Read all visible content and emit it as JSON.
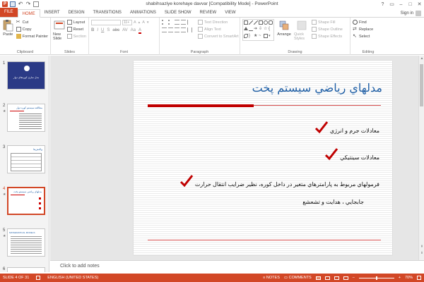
{
  "window": {
    "title": "shabihsaziye korehaye davvar [Compatibility Mode] - PowerPoint",
    "controls": [
      "?",
      "▭",
      "–",
      "□",
      "✕"
    ]
  },
  "tabs": [
    "FILE",
    "HOME",
    "INSERT",
    "DESIGN",
    "TRANSITIONS",
    "ANIMATIONS",
    "SLIDE SHOW",
    "REVIEW",
    "VIEW"
  ],
  "active_tab": "HOME",
  "signin": "Sign in",
  "ribbon": {
    "clipboard": {
      "paste": "Paste",
      "cut": "Cut",
      "copy": "Copy",
      "format_painter": "Format Painter",
      "label": "Clipboard"
    },
    "slides": {
      "new_slide": "New Slide",
      "layout": "Layout",
      "reset": "Reset",
      "section": "Section",
      "label": "Slides"
    },
    "font": {
      "size": "11+",
      "label": "Font",
      "buttons": [
        "B",
        "I",
        "U",
        "S",
        "abc",
        "AV",
        "Aa",
        "A"
      ]
    },
    "paragraph": {
      "text_direction": "Text Direction",
      "align_text": "Align Text",
      "convert_smartart": "Convert to SmartArt",
      "label": "Paragraph"
    },
    "drawing": {
      "arrange": "Arrange",
      "quick_styles": "Quick Styles",
      "shape_fill": "Shape Fill",
      "shape_outline": "Shape Outline",
      "shape_effects": "Shape Effects",
      "label": "Drawing"
    },
    "editing": {
      "find": "Find",
      "replace": "Replace",
      "select": "Select",
      "label": "Editing"
    }
  },
  "thumbnails": [
    {
      "num": "1",
      "star": ""
    },
    {
      "num": "2",
      "star": "★"
    },
    {
      "num": "3",
      "star": ""
    },
    {
      "num": "4",
      "star": "★"
    },
    {
      "num": "5",
      "star": "★"
    },
    {
      "num": "6",
      "star": ""
    }
  ],
  "thumb_texts": {
    "t1_title": "مدل سازی کوره‌های دوار",
    "t2_title": "مطالعه سیستم کوره دوار",
    "t3_title": "واکنش‌ها",
    "t4_title": "مدلهای ریاضی سیستم پخت",
    "t5_title": "MATHEMATICAL MODELS"
  },
  "slide": {
    "title": "مدلهاي رياضي سيستم پخت",
    "bullets": [
      "معادلات جرم و انرژي",
      "معادلات سينتيكي",
      "فرمولهاي مربوط به پارامترهاي متغير در داخل كوره، نظير ضرايب انتقال حرارت",
      "جابجايي ، هدايت و تشعشع"
    ]
  },
  "notes_placeholder": "Click to add notes",
  "status": {
    "slide_count": "SLIDE 4 OF 31",
    "language": "ENGLISH (UNITED STATES)",
    "notes": "NOTES",
    "comments": "COMMENTS",
    "zoom": "70%",
    "zoom_minus": "–",
    "zoom_plus": "+"
  },
  "colors": {
    "accent": "#d24726",
    "title_blue": "#1f5fa6",
    "check_red": "#c00000"
  }
}
